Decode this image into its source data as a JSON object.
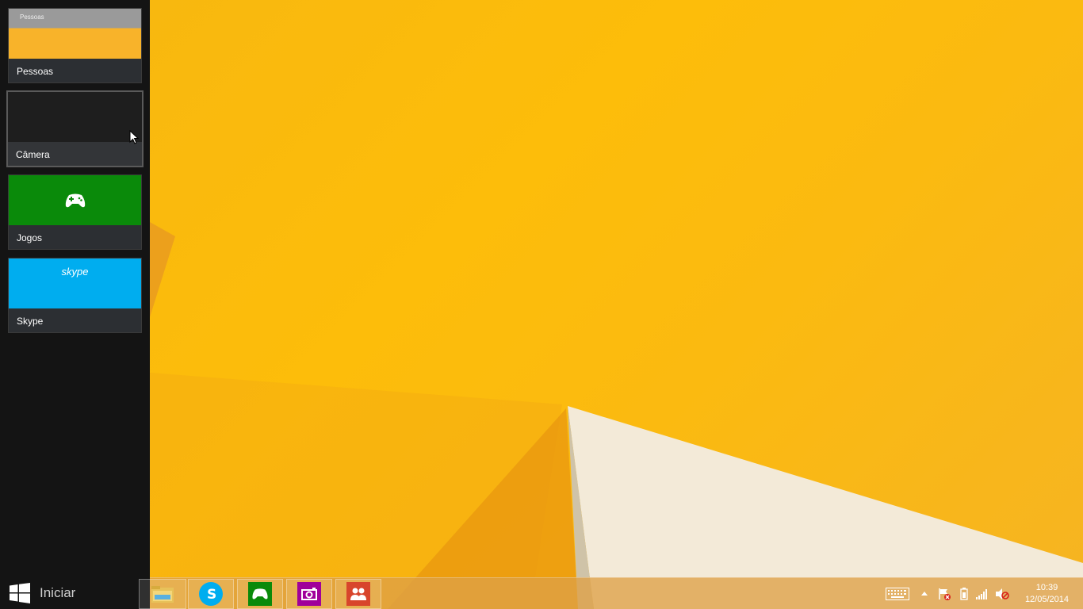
{
  "switcher": {
    "apps": [
      {
        "label": "Pessoas",
        "preview_title": "Pessoas"
      },
      {
        "label": "Câmera"
      },
      {
        "label": "Jogos"
      },
      {
        "label": "Skype",
        "preview_logo": "skype"
      }
    ]
  },
  "start": {
    "label": "Iniciar",
    "icon": "windows-logo-icon"
  },
  "taskbar": {
    "pinned": [
      {
        "name": "file-explorer",
        "icon": "folder-icon"
      },
      {
        "name": "skype",
        "icon": "skype-icon",
        "color": "#00adef"
      },
      {
        "name": "jogos",
        "icon": "game-controller-icon",
        "color": "#0a8a0a"
      },
      {
        "name": "camera",
        "icon": "camera-icon",
        "color": "#a0009a"
      },
      {
        "name": "pessoas",
        "icon": "people-icon",
        "color": "#d8452c"
      }
    ],
    "clock": {
      "time": "10:39",
      "date": "12/05/2014"
    }
  },
  "colors": {
    "wallpaper": "#fdbd0a",
    "sidebar": "#141414"
  }
}
